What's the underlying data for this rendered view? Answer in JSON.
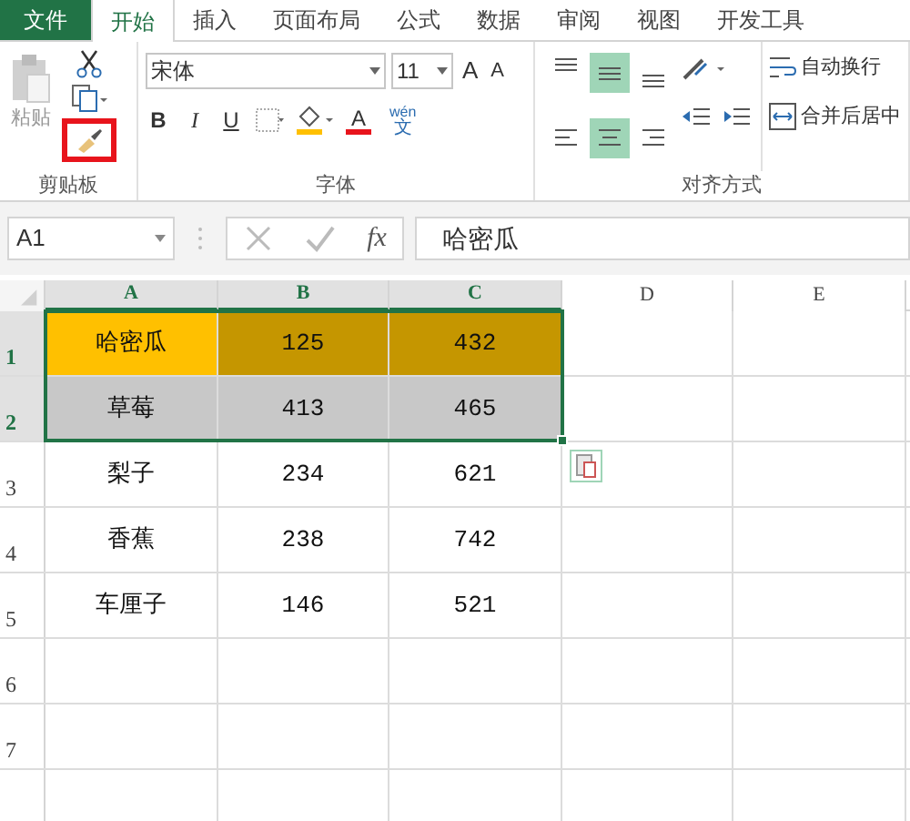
{
  "tabs": [
    {
      "label": "文件",
      "kind": "file",
      "selected": false
    },
    {
      "label": "开始",
      "kind": "tab",
      "selected": true
    },
    {
      "label": "插入",
      "kind": "tab",
      "selected": false
    },
    {
      "label": "页面布局",
      "kind": "tab",
      "selected": false
    },
    {
      "label": "公式",
      "kind": "tab",
      "selected": false
    },
    {
      "label": "数据",
      "kind": "tab",
      "selected": false
    },
    {
      "label": "审阅",
      "kind": "tab",
      "selected": false
    },
    {
      "label": "视图",
      "kind": "tab",
      "selected": false
    },
    {
      "label": "开发工具",
      "kind": "tab",
      "selected": false
    }
  ],
  "ribbon": {
    "clipboard": {
      "paste_label": "粘贴",
      "format_painter_highlighted": true,
      "group_label": "剪贴板"
    },
    "font": {
      "font_name": "宋体",
      "font_size": "11",
      "grow_glyph": "A",
      "shrink_glyph": "A",
      "bold": "B",
      "italic": "I",
      "underline": "U",
      "font_color_glyph": "A",
      "phonetic_top": "wén",
      "phonetic_bottom": "文",
      "group_label": "字体"
    },
    "alignment": {
      "buttons": [
        {
          "kind": "top",
          "selected": false
        },
        {
          "kind": "middle",
          "selected": true
        },
        {
          "kind": "bottom",
          "selected": false
        },
        {
          "kind": "left",
          "selected": false
        },
        {
          "kind": "center",
          "selected": true
        },
        {
          "kind": "right",
          "selected": false
        }
      ],
      "wrap_text": "自动换行",
      "merge_center": "合并后居中",
      "group_label": "对齐方式"
    }
  },
  "formula_bar": {
    "name_box": "A1",
    "fx": "fx",
    "value": "哈密瓜"
  },
  "sheet": {
    "columns": [
      {
        "label": "A",
        "selected": true
      },
      {
        "label": "B",
        "selected": true
      },
      {
        "label": "C",
        "selected": true
      },
      {
        "label": "D",
        "selected": false
      },
      {
        "label": "E",
        "selected": false
      }
    ],
    "rows": [
      {
        "label": "1",
        "selected": true,
        "cells": [
          {
            "text": "哈密瓜",
            "color": "#ffc000"
          },
          {
            "text": "125",
            "color": "#c59600"
          },
          {
            "text": "432",
            "color": "#c59600"
          }
        ]
      },
      {
        "label": "2",
        "selected": true,
        "cells": [
          {
            "text": "草莓",
            "color": "#c8c8c8"
          },
          {
            "text": "413",
            "color": "#c8c8c8"
          },
          {
            "text": "465",
            "color": "#c8c8c8"
          }
        ]
      },
      {
        "label": "3",
        "selected": false,
        "cells": [
          {
            "text": "梨子"
          },
          {
            "text": "234"
          },
          {
            "text": "621"
          }
        ]
      },
      {
        "label": "4",
        "selected": false,
        "cells": [
          {
            "text": "香蕉"
          },
          {
            "text": "238"
          },
          {
            "text": "742"
          }
        ]
      },
      {
        "label": "5",
        "selected": false,
        "cells": [
          {
            "text": "车厘子"
          },
          {
            "text": "146"
          },
          {
            "text": "521"
          }
        ]
      },
      {
        "label": "6",
        "selected": false
      },
      {
        "label": "7",
        "selected": false
      }
    ]
  }
}
